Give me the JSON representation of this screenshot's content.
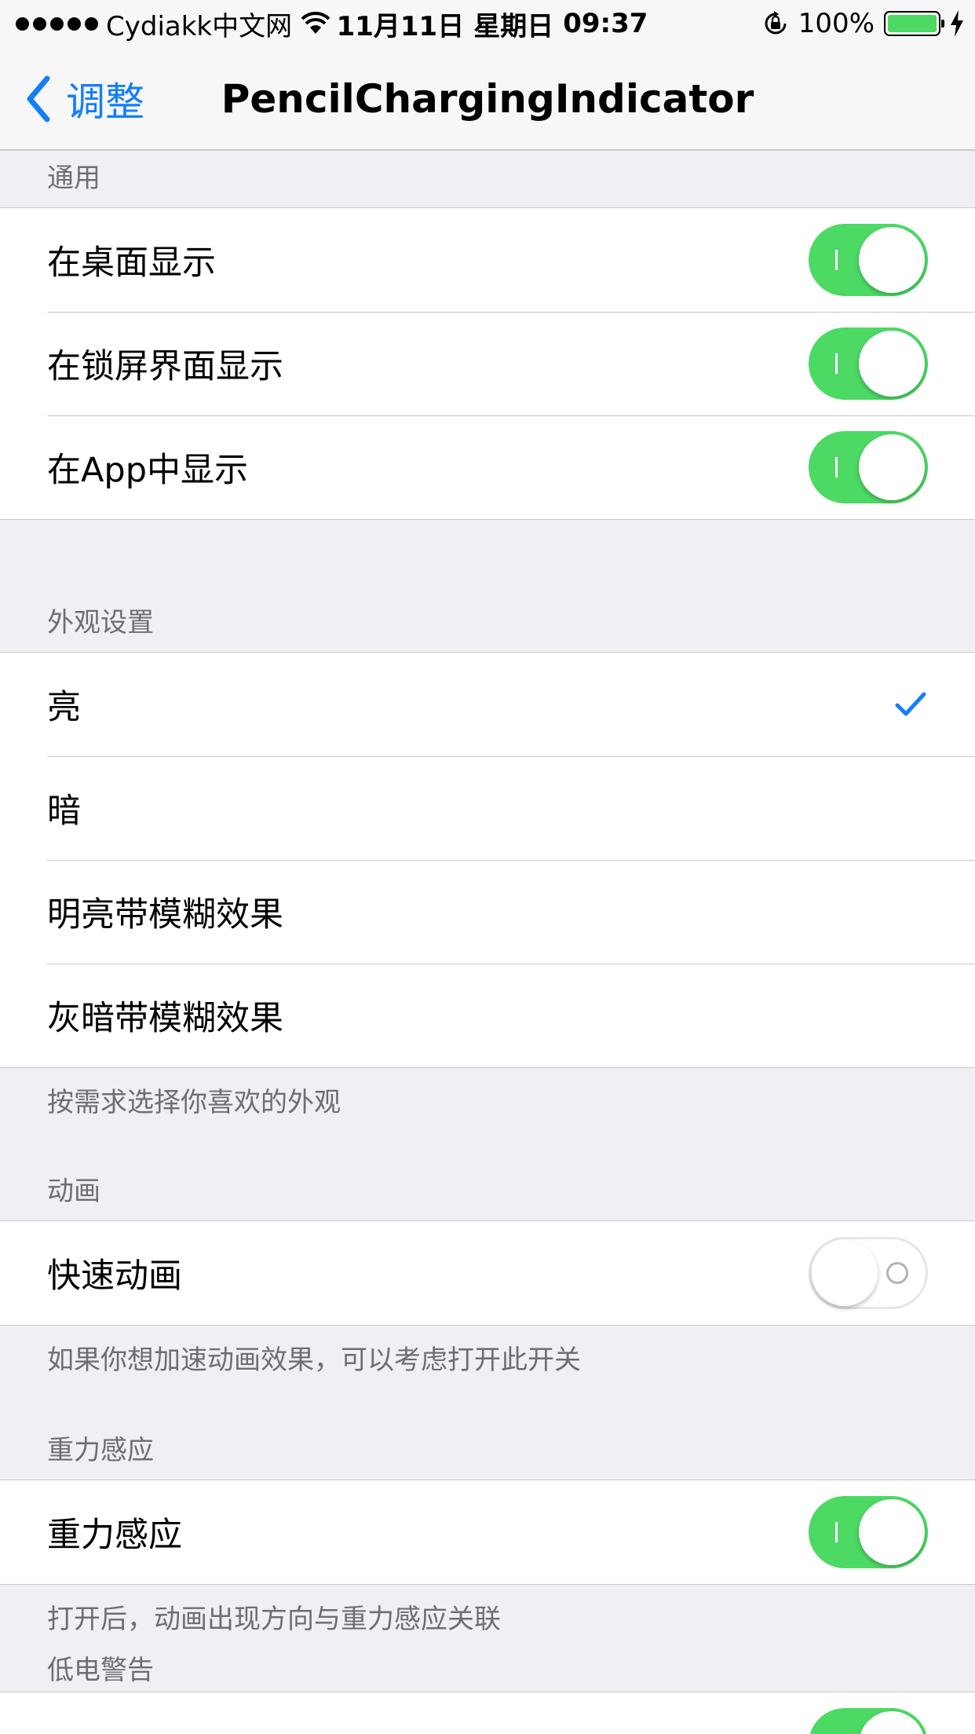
{
  "status_bar": {
    "carrier": "Cydiakk中文网",
    "date": "11月11日",
    "weekday": "星期日",
    "time": "09:37",
    "battery": "100%",
    "battery_fill": 1.0
  },
  "nav": {
    "back_label": "调整",
    "title": "PencilChargingIndicator"
  },
  "sections": {
    "general": {
      "header": "通用",
      "items": [
        {
          "label": "在桌面显示",
          "on": true
        },
        {
          "label": "在锁屏界面显示",
          "on": true
        },
        {
          "label": "在App中显示",
          "on": true
        }
      ]
    },
    "appearance": {
      "header": "外观设置",
      "options": [
        "亮",
        "暗",
        "明亮带模糊效果",
        "灰暗带模糊效果"
      ],
      "selected": "亮",
      "footer": "按需求选择你喜欢的外观"
    },
    "animation": {
      "header": "动画",
      "item": {
        "label": "快速动画",
        "on": false
      },
      "footer": "如果你想加速动画效果，可以考虑打开此开关"
    },
    "gravity": {
      "header": "重力感应",
      "item": {
        "label": "重力感应",
        "on": true
      },
      "footer": "打开后，动画出现方向与重力感应关联"
    },
    "low_battery": {
      "header": "低电警告"
    }
  },
  "colors": {
    "accent": "#147efb",
    "switch_on": "#4cd964",
    "background": "#efeff4"
  }
}
